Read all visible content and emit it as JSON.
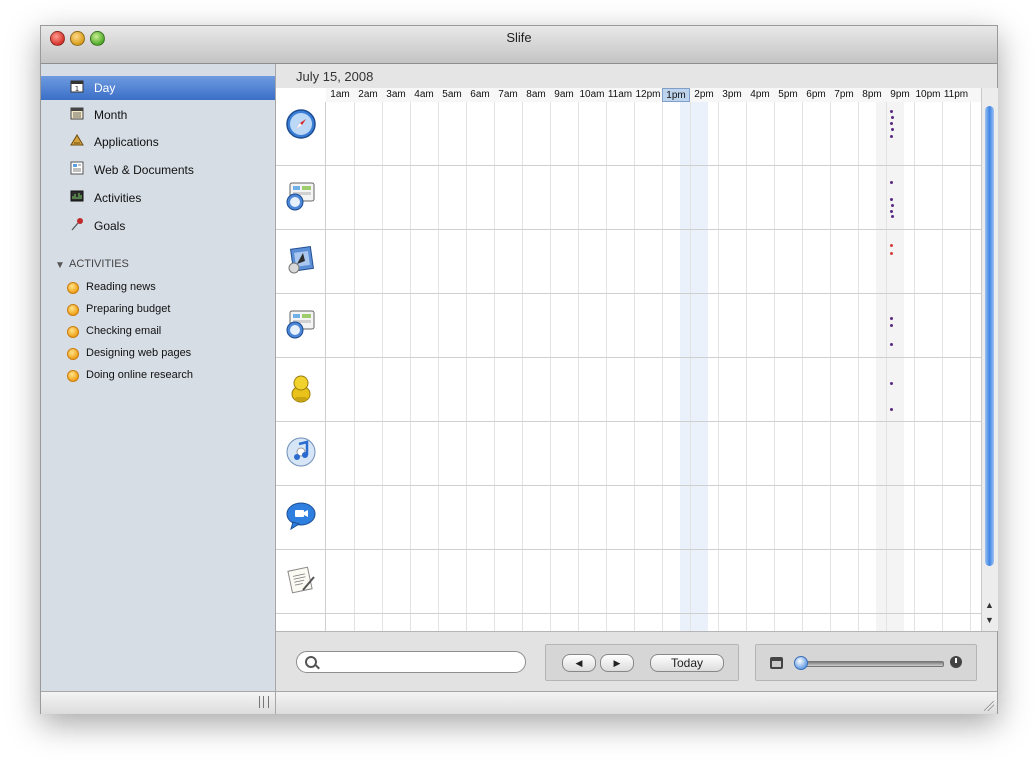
{
  "window": {
    "title": "Slife"
  },
  "sidebar": {
    "items": [
      {
        "label": "Day",
        "icon": "calendar-day-icon",
        "selected": true
      },
      {
        "label": "Month",
        "icon": "calendar-month-icon"
      },
      {
        "label": "Applications",
        "icon": "applications-icon"
      },
      {
        "label": "Web & Documents",
        "icon": "web-documents-icon"
      },
      {
        "label": "Activities",
        "icon": "activities-icon"
      },
      {
        "label": "Goals",
        "icon": "goals-pin-icon"
      }
    ],
    "section_title": "ACTIVITIES",
    "activities": [
      {
        "label": "Reading news"
      },
      {
        "label": "Preparing budget"
      },
      {
        "label": "Checking email"
      },
      {
        "label": "Designing web pages"
      },
      {
        "label": "Doing online research"
      }
    ]
  },
  "main": {
    "date": "July 15, 2008",
    "hours": [
      "1am",
      "2am",
      "3am",
      "4am",
      "5am",
      "6am",
      "7am",
      "8am",
      "9am",
      "10am",
      "11am",
      "12pm",
      "1pm",
      "2pm",
      "3pm",
      "4pm",
      "5pm",
      "6pm",
      "7pm",
      "8pm",
      "9pm",
      "10pm",
      "11pm"
    ],
    "selected_hour": "1pm",
    "rows": [
      {
        "app_icon": "safari-icon",
        "color": "#5a2a82",
        "activity_at": "8pm"
      },
      {
        "app_icon": "dashboard-icon",
        "color": "#5a2a82",
        "activity_at": "8pm"
      },
      {
        "app_icon": "mail-icon",
        "color": "#d43b3b",
        "activity_at": "8pm"
      },
      {
        "app_icon": "dashboard-icon",
        "color": "#5a2a82",
        "activity_at": "8pm"
      },
      {
        "app_icon": "adium-icon",
        "color": "#5a2a82",
        "activity_at": "8pm"
      },
      {
        "app_icon": "itunes-icon"
      },
      {
        "app_icon": "ichat-icon"
      },
      {
        "app_icon": "textedit-icon"
      },
      {
        "app_icon": "ical-icon"
      }
    ]
  },
  "bottom": {
    "search_placeholder": "",
    "prev_label": "◀",
    "next_label": "▶",
    "today_label": "Today",
    "zoom_min_icon": "calendar-15-icon",
    "zoom_max_icon": "clock-icon",
    "zoom_level": 0
  }
}
